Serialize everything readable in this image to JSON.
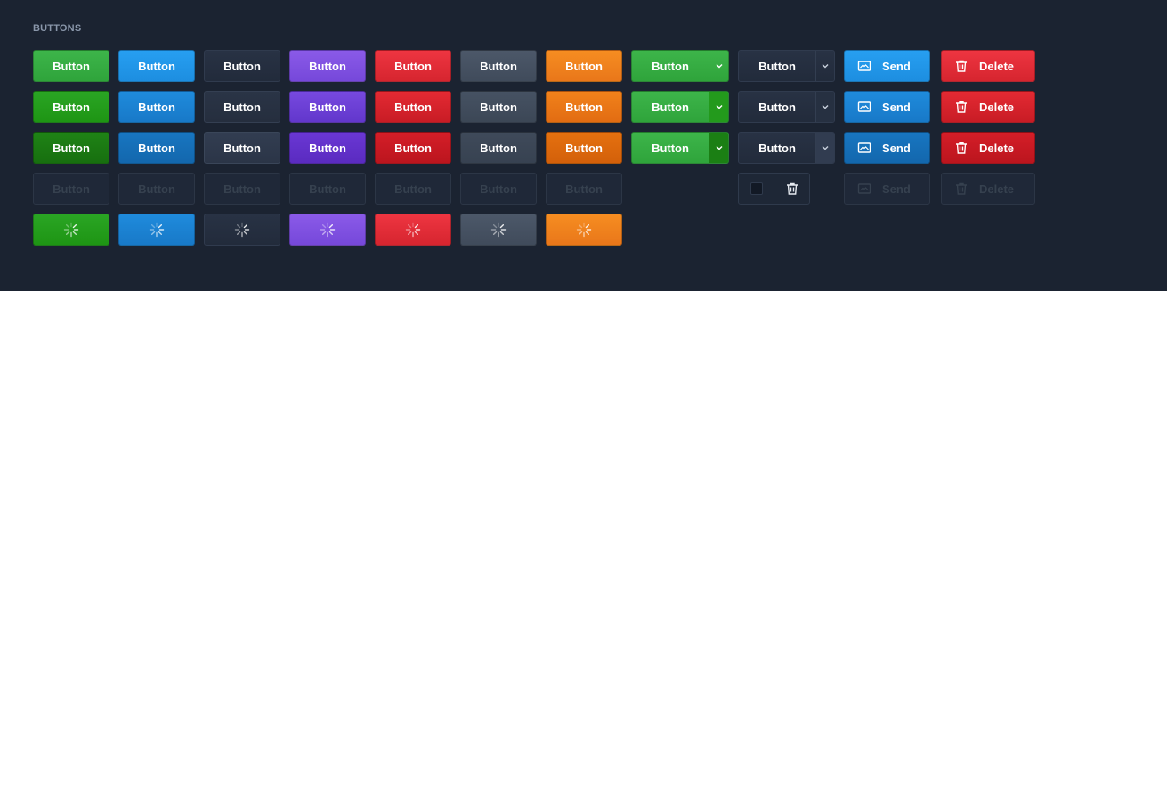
{
  "section": {
    "title": "BUTTONS"
  },
  "button_label": "Button",
  "send_label": "Send",
  "delete_label": "Delete",
  "colors": {
    "green": "#3db54a",
    "blue": "#279ff1",
    "dark": "#283244",
    "purple": "#8a5ae8",
    "red": "#ee3541",
    "slate": "#4c5869",
    "orange": "#f68d21",
    "panel": "#1b2331"
  },
  "rows": [
    "default",
    "hover",
    "active",
    "disabled",
    "loading"
  ],
  "variants": [
    "green",
    "blue",
    "dark",
    "purple",
    "red",
    "slate",
    "orange"
  ],
  "icons": {
    "send": "envelope-icon",
    "delete": "trash-icon",
    "caret": "chevron-down-icon",
    "loading": "spinner-icon"
  }
}
